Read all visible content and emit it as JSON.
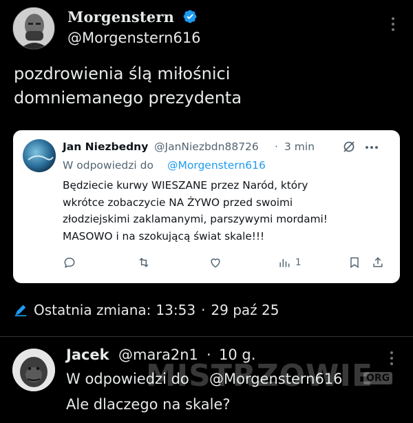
{
  "post": {
    "author_name": "Morgenstern",
    "author_handle": "@Morgenstern616",
    "verified": true,
    "text": "pozdrowienia ślą miłośnici\ndomniemanego prezydenta"
  },
  "quote": {
    "author_name": "Jan Niezbedny",
    "author_handle": "@JanNiezbdn88726",
    "separator": "·",
    "time": "3 min",
    "reply_to_label": "W odpowiedzi do",
    "reply_to_handle": "@Morgenstern616",
    "body": "Będziecie kurwy WIESZANE przez Naród, który\nwkrótce zobaczycie NA ŻYWO przed swoimi\nzłodziejskimi zaklamanymi, parszywymi mordami!\nMASOWO i na szokującą świat skale!!!",
    "actions": {
      "reply_icon": "reply-icon",
      "repost_icon": "repost-icon",
      "like_icon": "heart-icon",
      "views_icon": "analytics-icon",
      "views_count": "1",
      "bookmark_icon": "bookmark-icon",
      "share_icon": "share-icon"
    }
  },
  "edit": {
    "label": "Ostatnia zmiana:",
    "time": "13:53",
    "separator": "·",
    "date": "29 paź 25"
  },
  "reply": {
    "author_name": "Jacek",
    "author_handle": "@mara2n1",
    "separator": "·",
    "time": "10 g.",
    "reply_to_label": "W odpowiedzi do",
    "reply_to_handle": "@Morgenstern616",
    "text": "Ale dlaczego na skale?"
  },
  "watermark": {
    "text": "MISTRZOWIE",
    "org": "ORG"
  },
  "colors": {
    "background": "#000000",
    "text": "#e7e9ea",
    "accent": "#1d9bf0",
    "card_bg": "#ffffff",
    "muted": "#536471"
  }
}
